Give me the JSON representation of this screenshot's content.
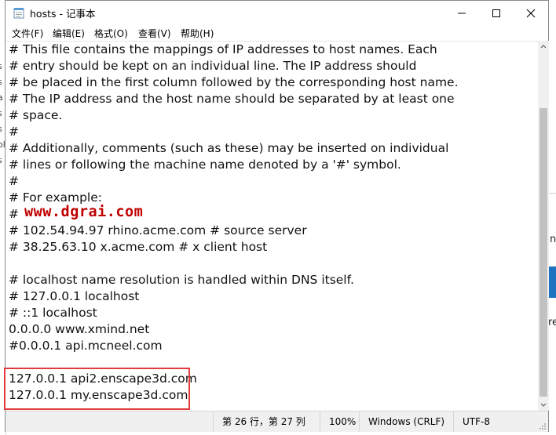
{
  "window": {
    "title": "hosts - 记事本",
    "icon": "notepad-icon",
    "controls": [
      "minimize-icon",
      "maximize-icon",
      "close-icon"
    ]
  },
  "menu": [
    {
      "label": "文件(F)"
    },
    {
      "label": "编辑(E)"
    },
    {
      "label": "格式(O)"
    },
    {
      "label": "查看(V)"
    },
    {
      "label": "帮助(H)"
    }
  ],
  "editor": {
    "lines": [
      "# This file contains the mappings of IP addresses to host names. Each",
      "# entry should be kept on an individual line. The IP address should",
      "# be placed in the first column followed by the corresponding host name.",
      "# The IP address and the host name should be separated by at least one",
      "# space.",
      "#",
      "# Additionally, comments (such as these) may be inserted on individual",
      "# lines or following the machine name denoted by a '#' symbol.",
      "#",
      "# For example:",
      "#",
      "# 102.54.94.97 rhino.acme.com # source server",
      "# 38.25.63.10 x.acme.com # x client host",
      "",
      "# localhost name resolution is handled within DNS itself.",
      "# 127.0.0.1 localhost",
      "# ::1 localhost",
      "0.0.0.0 www.xmind.net",
      "#0.0.0.1 api.mcneel.com",
      "",
      "127.0.0.1 api2.enscape3d.com",
      "127.0.0.1 my.enscape3d.com"
    ],
    "watermark": "www.dgrai.com",
    "highlight_color": "#e23b3b",
    "watermark_color": "#c00000"
  },
  "status": {
    "position": "第 26 行，第 27 列",
    "zoom": "100%",
    "line_ending": "Windows (CRLF)",
    "encoding": "UTF-8"
  },
  "background": {
    "left_chars": [
      "s",
      "s",
      "a",
      "s",
      "s",
      "ol",
      "s"
    ],
    "right_chars": [
      "n",
      "re"
    ]
  }
}
